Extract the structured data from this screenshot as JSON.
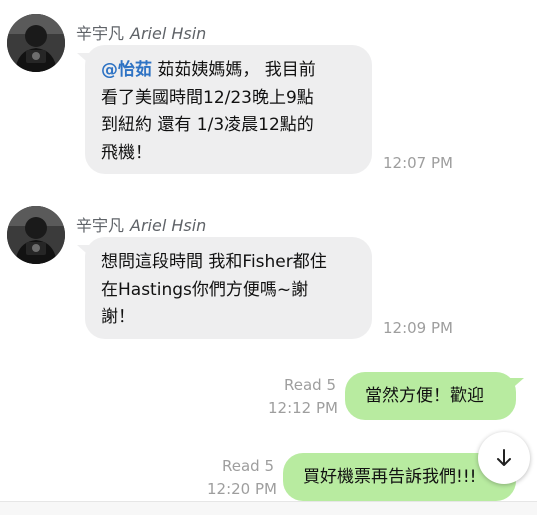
{
  "messages": [
    {
      "sender_cn": "辛宇凡",
      "sender_en": "Ariel Hsin",
      "mention": "@怡茹",
      "lines": [
        "茹茹姨媽媽， 我目前",
        "看了美國時間12/23晚上9點",
        "到紐約 還有 1/3凌晨12點的",
        "飛機！"
      ],
      "time": "12:07 PM"
    },
    {
      "sender_cn": "辛宇凡",
      "sender_en": "Ariel Hsin",
      "lines": [
        "想問這段時間 我和Fisher都住",
        "在Hastings你們方便嗎~謝",
        "謝！"
      ],
      "time": "12:09 PM"
    },
    {
      "read": "Read 5",
      "text": "當然方便！歡迎",
      "time": "12:12 PM"
    },
    {
      "read": "Read 5",
      "text": "買好機票再告訴我們!!!",
      "time": "12:20 PM"
    }
  ],
  "icons": {
    "avatar": "profile-photo",
    "scroll_down": "arrow-down-icon"
  },
  "colors": {
    "incoming_bubble": "#eeeeef",
    "outgoing_bubble": "#b8eba0",
    "mention": "#2e73c4",
    "meta_text": "#9e9e9e"
  }
}
